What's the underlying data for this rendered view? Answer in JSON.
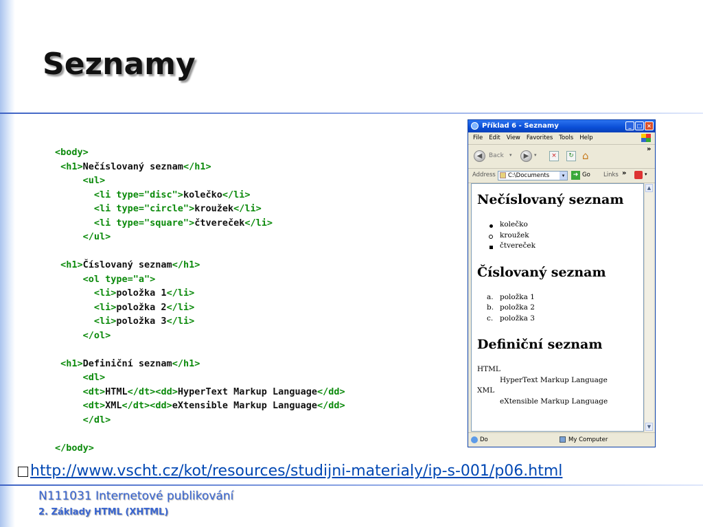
{
  "slide": {
    "title": "Seznamy",
    "link_url": "http://www.vscht.cz/kot/resources/studijni-materialy/ip-s-001/p06.html",
    "footer_course": "N111031 Internetové publikování",
    "footer_chapter": "2. Základy HTML (XHTML)"
  },
  "code_lines": [
    [
      {
        "t": "tag",
        "v": "<body>"
      }
    ],
    [
      {
        "t": "tag",
        "v": " <h1>"
      },
      {
        "t": "txt",
        "v": "Nečíslovaný seznam"
      },
      {
        "t": "tag",
        "v": "</h1>"
      }
    ],
    [
      {
        "t": "tag",
        "v": "     <ul>"
      }
    ],
    [
      {
        "t": "tag",
        "v": "       <li type=\"disc\">"
      },
      {
        "t": "txt",
        "v": "kolečko"
      },
      {
        "t": "tag",
        "v": "</li>"
      }
    ],
    [
      {
        "t": "tag",
        "v": "       <li type=\"circle\">"
      },
      {
        "t": "txt",
        "v": "kroužek"
      },
      {
        "t": "tag",
        "v": "</li>"
      }
    ],
    [
      {
        "t": "tag",
        "v": "       <li type=\"square\">"
      },
      {
        "t": "txt",
        "v": "čtvereček"
      },
      {
        "t": "tag",
        "v": "</li>"
      }
    ],
    [
      {
        "t": "tag",
        "v": "     </ul>"
      }
    ],
    [],
    [
      {
        "t": "tag",
        "v": " <h1>"
      },
      {
        "t": "txt",
        "v": "Číslovaný seznam"
      },
      {
        "t": "tag",
        "v": "</h1>"
      }
    ],
    [
      {
        "t": "tag",
        "v": "     <ol type=\"a\">"
      }
    ],
    [
      {
        "t": "tag",
        "v": "       <li>"
      },
      {
        "t": "txt",
        "v": "položka 1"
      },
      {
        "t": "tag",
        "v": "</li>"
      }
    ],
    [
      {
        "t": "tag",
        "v": "       <li>"
      },
      {
        "t": "txt",
        "v": "položka 2"
      },
      {
        "t": "tag",
        "v": "</li>"
      }
    ],
    [
      {
        "t": "tag",
        "v": "       <li>"
      },
      {
        "t": "txt",
        "v": "položka 3"
      },
      {
        "t": "tag",
        "v": "</li>"
      }
    ],
    [
      {
        "t": "tag",
        "v": "     </ol>"
      }
    ],
    [],
    [
      {
        "t": "tag",
        "v": " <h1>"
      },
      {
        "t": "txt",
        "v": "Definiční seznam"
      },
      {
        "t": "tag",
        "v": "</h1>"
      }
    ],
    [
      {
        "t": "tag",
        "v": "     <dl>"
      }
    ],
    [
      {
        "t": "tag",
        "v": "     <dt>"
      },
      {
        "t": "txt",
        "v": "HTML"
      },
      {
        "t": "tag",
        "v": "</dt><dd>"
      },
      {
        "t": "txt",
        "v": "HyperText Markup Language"
      },
      {
        "t": "tag",
        "v": "</dd>"
      }
    ],
    [
      {
        "t": "tag",
        "v": "     <dt>"
      },
      {
        "t": "txt",
        "v": "XML"
      },
      {
        "t": "tag",
        "v": "</dt><dd>"
      },
      {
        "t": "txt",
        "v": "eXtensible Markup Language"
      },
      {
        "t": "tag",
        "v": "</dd>"
      }
    ],
    [
      {
        "t": "tag",
        "v": "     </dl>"
      }
    ],
    [],
    [
      {
        "t": "tag",
        "v": "</body>"
      }
    ]
  ],
  "browser": {
    "window_title": "Příklad 6 - Seznamy",
    "menu": [
      "File",
      "Edit",
      "View",
      "Favorites",
      "Tools",
      "Help"
    ],
    "back_label": "Back",
    "address_label": "Address",
    "address_value": "C:\\Documents",
    "go_label": "Go",
    "links_label": "Links",
    "status_left": "Do",
    "status_zone": "My Computer",
    "page": {
      "h1_unordered": "Nečíslovaný seznam",
      "ul_items": [
        "kolečko",
        "kroužek",
        "čtvereček"
      ],
      "h1_ordered": "Číslovaný seznam",
      "ol_markers": [
        "a.",
        "b.",
        "c."
      ],
      "ol_items": [
        "položka 1",
        "položka 2",
        "položka 3"
      ],
      "h1_definition": "Definiční seznam",
      "dl": [
        {
          "dt": "HTML",
          "dd": "HyperText Markup Language"
        },
        {
          "dt": "XML",
          "dd": "eXtensible Markup Language"
        }
      ]
    }
  }
}
